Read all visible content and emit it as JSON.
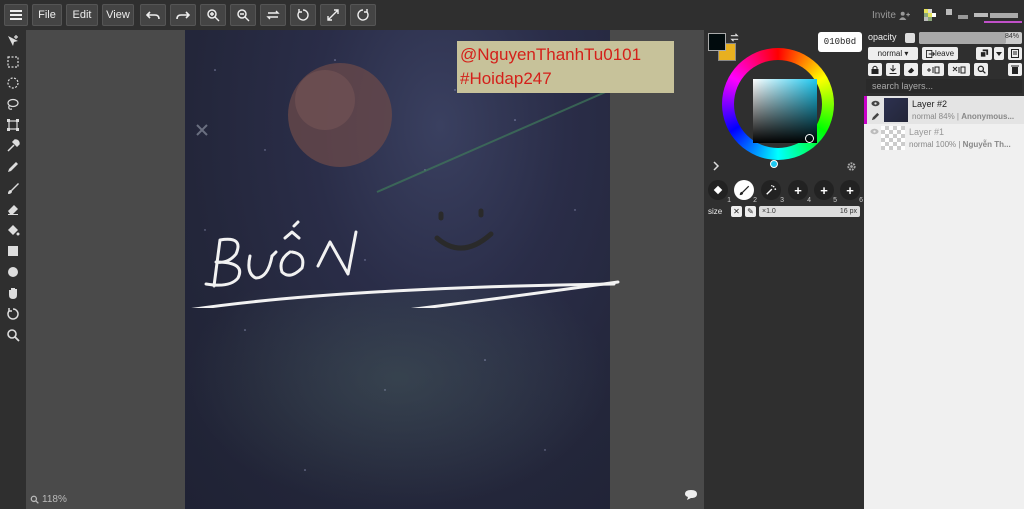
{
  "toolbar": {
    "menu_icon": "hamburger-icon",
    "file": "File",
    "edit": "Edit",
    "view": "View",
    "icons": [
      "undo-icon",
      "redo-icon",
      "zoom-in-icon",
      "zoom-out-icon",
      "flip-icon",
      "rotate-left-icon",
      "fullscreen-icon",
      "rotate-right-icon"
    ]
  },
  "tools": [
    "move-icon",
    "rect-select-icon",
    "ellipse-select-icon",
    "lasso-icon",
    "transform-icon",
    "eyedropper-icon",
    "pencil-icon",
    "brush-icon",
    "eraser-icon",
    "fill-icon",
    "rectangle-icon",
    "circle-icon",
    "hand-icon",
    "rotate-view-icon",
    "zoom-icon"
  ],
  "canvas": {
    "zoom": "118%",
    "watermark_line1": "@NguyenThanhTu0101",
    "watermark_line2": "#Hoidap247",
    "drawn_text": "BUỒN"
  },
  "color": {
    "hex": "010b0d",
    "primary": "#010b0d",
    "secondary": "#e8b020",
    "selected": "#2eb4d8"
  },
  "brushes": [
    {
      "index": "1",
      "icon": "fill-icon"
    },
    {
      "index": "2",
      "icon": "brush-icon"
    },
    {
      "index": "3",
      "icon": "spray-icon"
    },
    {
      "index": "4",
      "icon": "plus-icon"
    },
    {
      "index": "5",
      "icon": "plus-icon"
    },
    {
      "index": "6",
      "icon": "plus-icon"
    }
  ],
  "size": {
    "label": "size",
    "multiplier": "×1.0",
    "value": "16 px"
  },
  "layers_panel": {
    "invite": "Invite",
    "opacity_label": "opacity",
    "opacity_value": "84%",
    "opacity_fraction": 0.84,
    "blend_mode": "normal ▾",
    "leave": "leave",
    "search_placeholder": "search layers...",
    "layers": [
      {
        "name": "Layer #2",
        "info": "normal 84% | ",
        "owner": "Anonymous...",
        "selected": true
      },
      {
        "name": "Layer #1",
        "info": "normal 100% | ",
        "owner": "Nguyễn Th...",
        "selected": false
      }
    ]
  }
}
